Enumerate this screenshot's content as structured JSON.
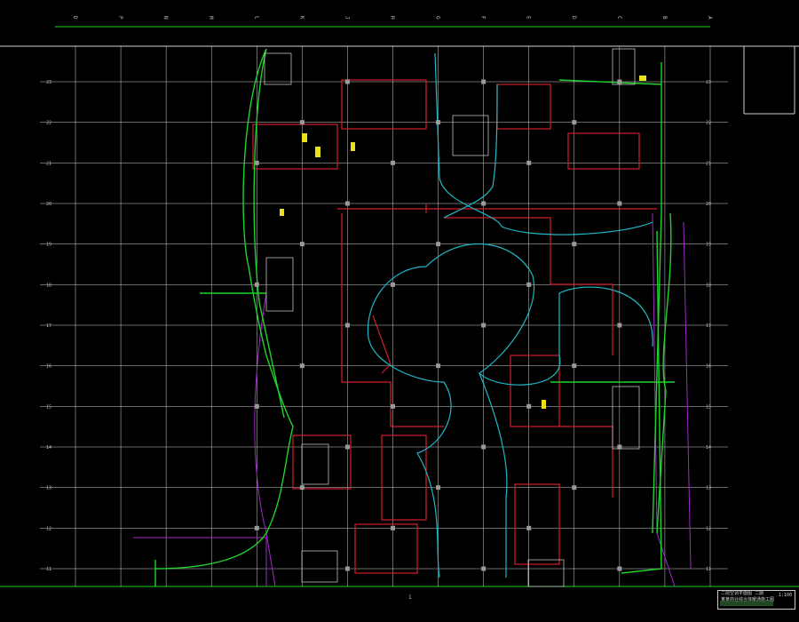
{
  "drawing": {
    "column_labels_top": [
      "D",
      "P",
      "N",
      "M",
      "L",
      "K",
      "J",
      "H",
      "G",
      "F",
      "E",
      "D",
      "C",
      "B",
      "A"
    ],
    "row_labels_left": [
      "23",
      "22",
      "21",
      "20",
      "19",
      "18",
      "17",
      "16",
      "15",
      "14",
      "13",
      "12",
      "11"
    ],
    "bottom_mark": "1",
    "colors": {
      "grid": "#cfcfcf",
      "wall": "#d01f2b",
      "pipe": "#1fd42a",
      "duct": "#1fb9c8",
      "boundary": "#a329c7",
      "column": "#9a9a9a",
      "label_yellow": "#e8e01a"
    }
  },
  "title_block": {
    "line1": "二层空调平面图 二期",
    "line2": "某某商业综合体暖通施工图",
    "scale": "1:100"
  }
}
